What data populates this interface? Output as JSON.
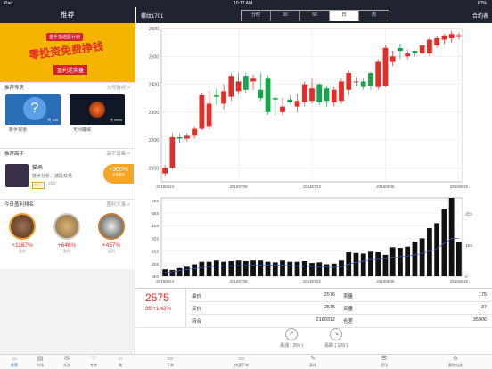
{
  "status": {
    "left": "iPad",
    "time": "10:17 AM",
    "battery": "67%"
  },
  "left_header": {
    "title": "推荐"
  },
  "banner": {
    "tag": "金手指选股计划",
    "headline": "零投资免费挣钱",
    "sub": "盈利送实盘"
  },
  "recommend": {
    "title": "推荐专房",
    "more": "大师做点 >",
    "cards": [
      {
        "name": "新手报道",
        "count": "共 100",
        "color": "#2a6eb8"
      },
      {
        "name": "无间魔域",
        "count": "共 9999",
        "color": "#101826"
      }
    ]
  },
  "experts": {
    "title": "推荐高手",
    "more": "高手云集 >",
    "name": "猫杀",
    "desc": "技术分析、波段交易",
    "tag_label": "粉丝",
    "fans": "222",
    "return_pct": "+300%",
    "return_label": "本年盈利"
  },
  "ranking": {
    "title": "今日盈利排名",
    "more": "盈利大事 >",
    "items": [
      {
        "pct": "+1187%",
        "label": "盈利"
      },
      {
        "pct": "+646%",
        "label": "盈利"
      },
      {
        "pct": "+457%",
        "label": "盈利"
      }
    ]
  },
  "tabbar": [
    "推荐",
    "市场",
    "交流",
    "专房",
    "我",
    "下单",
    "快速下单",
    "画线",
    "资讯",
    "删除自选"
  ],
  "right_header": {
    "title": "螺纹1701",
    "button": "合约表"
  },
  "segments": [
    "分时",
    "30",
    "60",
    "日",
    "周"
  ],
  "active_segment": "日",
  "chart_data": [
    {
      "type": "candlestick",
      "title": "",
      "x": [
        "20160624",
        "20160627",
        "20160628",
        "20160629",
        "20160630",
        "20160701",
        "20160704",
        "20160705",
        "20160706",
        "20160707",
        "20160708",
        "20160711",
        "20160712",
        "20160713",
        "20160714",
        "20160715",
        "20160718",
        "20160719",
        "20160720",
        "20160721",
        "20160722",
        "20160725",
        "20160726",
        "20160727",
        "20160728",
        "20160729",
        "20160801",
        "20160802",
        "20160803",
        "20160804",
        "20160805",
        "20160808",
        "20160809",
        "20160810",
        "20160811",
        "20160812",
        "20160815",
        "20160816",
        "20160817",
        "20160818",
        "20160819"
      ],
      "x_ticks": [
        "20160624",
        "20160708",
        "20160722",
        "20160805",
        "20160819"
      ],
      "ylim": [
        2050,
        2600
      ],
      "y_ticks": [
        2100,
        2200,
        2300,
        2400,
        2500,
        2600
      ],
      "open": [
        2080,
        2100,
        2210,
        2205,
        2215,
        2240,
        2250,
        2360,
        2330,
        2355,
        2375,
        2430,
        2410,
        2380,
        2420,
        2350,
        2300,
        2345,
        2320,
        2335,
        2340,
        2400,
        2385,
        2335,
        2340,
        2380,
        2410,
        2410,
        2440,
        2390,
        2395,
        2480,
        2530,
        2500,
        2520,
        2510,
        2510,
        2540,
        2560,
        2565,
        2575
      ],
      "close": [
        2100,
        2210,
        2205,
        2215,
        2240,
        2360,
        2330,
        2355,
        2375,
        2430,
        2410,
        2380,
        2420,
        2350,
        2300,
        2345,
        2320,
        2335,
        2340,
        2400,
        2385,
        2335,
        2340,
        2380,
        2410,
        2440,
        2410,
        2390,
        2395,
        2480,
        2530,
        2500,
        2520,
        2510,
        2510,
        2540,
        2560,
        2565,
        2575,
        2580,
        2576
      ],
      "high": [
        2110,
        2225,
        2225,
        2225,
        2250,
        2370,
        2380,
        2385,
        2400,
        2440,
        2440,
        2440,
        2435,
        2440,
        2430,
        2355,
        2350,
        2360,
        2365,
        2410,
        2420,
        2405,
        2395,
        2390,
        2420,
        2450,
        2425,
        2420,
        2445,
        2490,
        2540,
        2520,
        2545,
        2525,
        2520,
        2550,
        2570,
        2575,
        2580,
        2590,
        2585
      ],
      "low": [
        2070,
        2095,
        2190,
        2195,
        2205,
        2235,
        2240,
        2325,
        2310,
        2340,
        2365,
        2370,
        2380,
        2340,
        2290,
        2290,
        2290,
        2330,
        2300,
        2320,
        2330,
        2325,
        2320,
        2320,
        2330,
        2360,
        2395,
        2380,
        2380,
        2380,
        2390,
        2465,
        2490,
        2490,
        2500,
        2505,
        2500,
        2530,
        2545,
        2550,
        2560
      ]
    },
    {
      "type": "bar",
      "title": "",
      "x_ticks": [
        "20160624",
        "20160708",
        "20160722",
        "20160805",
        "20160819"
      ],
      "y_ticks_left": [
        "0E0",
        "1E6",
        "2E6",
        "3E6",
        "4E6",
        "5E6",
        "6E6"
      ],
      "y_ticks_right": [
        "0",
        "1E6",
        "2E6"
      ],
      "values": [
        0.55,
        0.5,
        0.65,
        0.75,
        0.95,
        1.15,
        1.15,
        1.25,
        1.15,
        1.2,
        1.25,
        1.2,
        1.25,
        1.25,
        1.15,
        1.1,
        1.25,
        1.15,
        1.15,
        1.2,
        1.05,
        1.1,
        0.95,
        1.0,
        1.25,
        1.9,
        1.85,
        1.8,
        1.95,
        1.9,
        1.7,
        2.3,
        2.25,
        2.35,
        2.75,
        3.0,
        3.8,
        4.2,
        5.3,
        6.2,
        2.7
      ],
      "ylim": [
        0,
        6.2
      ],
      "line": [
        0.3,
        0.35,
        0.45,
        0.55,
        0.6,
        0.7,
        0.75,
        0.8,
        0.8,
        0.82,
        0.85,
        0.85,
        0.88,
        0.9,
        0.9,
        0.88,
        0.88,
        0.85,
        0.82,
        0.8,
        0.78,
        0.75,
        0.72,
        0.7,
        0.75,
        0.95,
        1.1,
        1.2,
        1.3,
        1.35,
        1.38,
        1.5,
        1.55,
        1.6,
        1.7,
        1.8,
        2.0,
        2.2,
        2.6,
        3.0,
        3.0
      ]
    }
  ],
  "quote": {
    "price": "2575",
    "change": "36/+1.42%",
    "rows": [
      {
        "l1": "最价",
        "v1": "2576",
        "l2": "卖量",
        "v2": "175"
      },
      {
        "l1": "买价",
        "v1": "2575",
        "l2": "买量",
        "v2": "37"
      },
      {
        "l1": "持合",
        "v1": "2180312",
        "l2": "仓差",
        "v2": "35906"
      }
    ],
    "tools": [
      {
        "label": "看涨 ( 204 )"
      },
      {
        "label": "看跌 ( 129 )"
      }
    ]
  }
}
